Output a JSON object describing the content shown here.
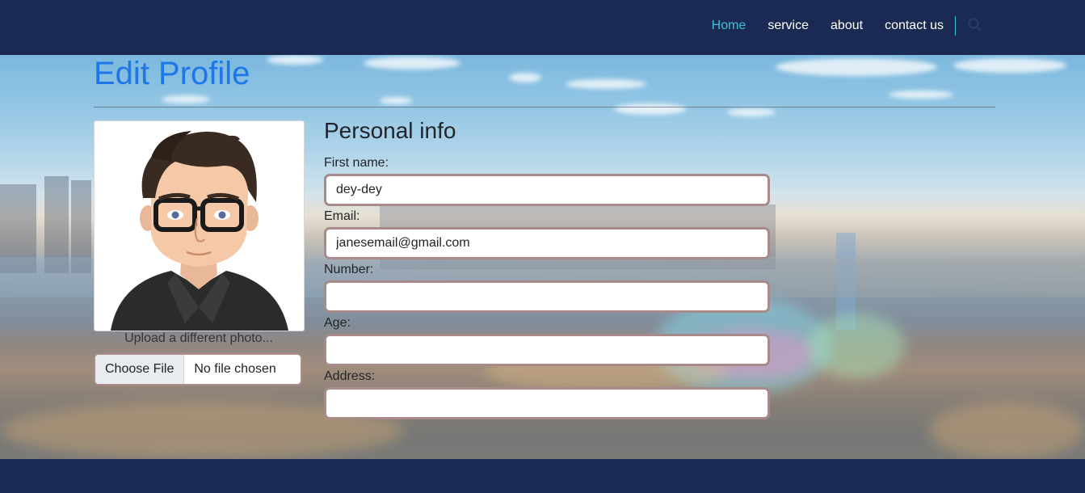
{
  "nav": {
    "links": [
      {
        "label": "Home",
        "active": true
      },
      {
        "label": "service",
        "active": false
      },
      {
        "label": "about",
        "active": false
      },
      {
        "label": "contact us",
        "active": false
      }
    ],
    "search_icon": "search-icon",
    "accent_color": "#3fc1d8",
    "background_color": "#1b2a52"
  },
  "page": {
    "title": "Edit Profile",
    "title_color": "#1d77e8"
  },
  "avatar": {
    "upload_caption": "Upload a different photo...",
    "choose_file_label": "Choose File",
    "file_status": "No file chosen"
  },
  "form": {
    "section_title": "Personal info",
    "fields": [
      {
        "label": "First name:",
        "value": "dey-dey"
      },
      {
        "label": "Email:",
        "value": "janesemail@gmail.com"
      },
      {
        "label": "Number:",
        "value": ""
      },
      {
        "label": "Age:",
        "value": ""
      },
      {
        "label": "Address:",
        "value": ""
      }
    ]
  }
}
